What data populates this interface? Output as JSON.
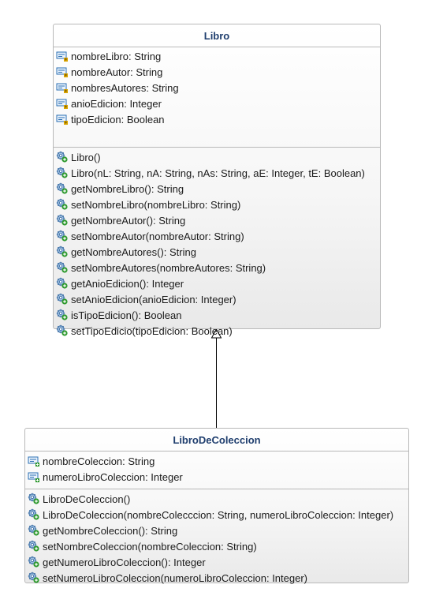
{
  "classes": {
    "libro": {
      "name": "Libro",
      "attributes": [
        "nombreLibro: String",
        "nombreAutor: String",
        "nombresAutores: String",
        "anioEdicion: Integer",
        "tipoEdicion: Boolean"
      ],
      "methods": [
        "Libro()",
        "Libro(nL: String, nA: String, nAs: String, aE: Integer, tE: Boolean)",
        "getNombreLibro(): String",
        "setNombreLibro(nombreLibro: String)",
        "getNombreAutor(): String",
        "setNombreAutor(nombreAutor: String)",
        "getNombreAutores(): String",
        "setNombreAutores(nombreAutores: String)",
        "getAnioEdicion(): Integer",
        "setAnioEdicion(anioEdicion: Integer)",
        "isTipoEdicion(): Boolean",
        "setTipoEdicio(tipoEdicion: Boolean)"
      ]
    },
    "libroDeColeccion": {
      "name": "LibroDeColeccion",
      "attributes": [
        "nombreColeccion: String",
        "numeroLibroColeccion: Integer"
      ],
      "methods": [
        "LibroDeColeccion()",
        "LibroDeColeccion(nombreColecccion: String, numeroLibroColeccion: Integer)",
        "getNombreColeccion(): String",
        "setNombreColeccion(nombreColeccion: String)",
        "getNumeroLibroColeccion(): Integer",
        "setNumeroLibroColeccion(numeroLibroColeccion: Integer)"
      ]
    }
  },
  "relationship": {
    "type": "generalization",
    "from": "LibroDeColeccion",
    "to": "Libro"
  },
  "icons": {
    "protected_attribute": "field-protected-icon",
    "public_attribute": "field-public-icon",
    "public_method": "method-public-icon"
  },
  "colors": {
    "class_title": "#1f3e6e",
    "border": "#b9b9b9",
    "field_icon": "#2b6fb3",
    "protected_marker": "#d9a400",
    "public_marker": "#2f9a2f"
  }
}
